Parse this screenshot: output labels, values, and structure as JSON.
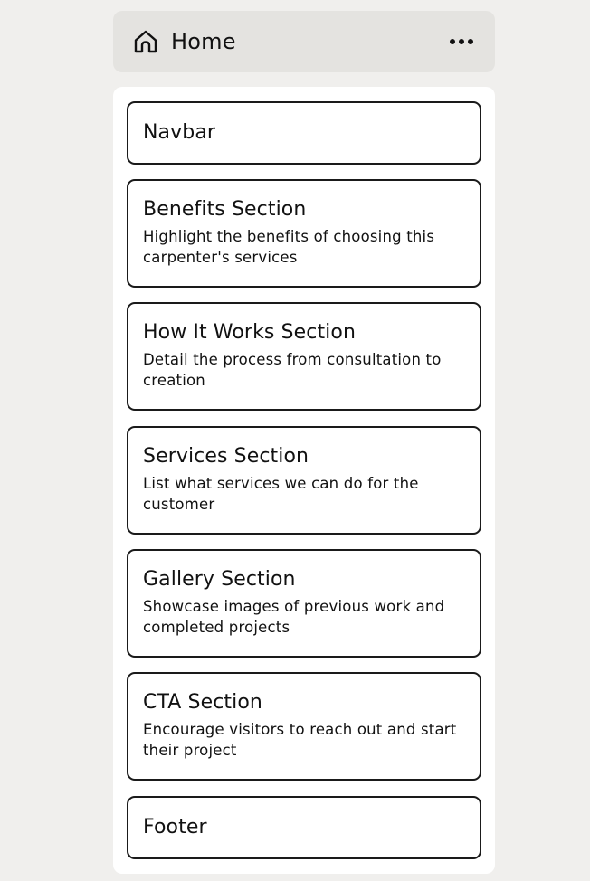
{
  "header": {
    "title": "Home",
    "icon": "home-icon",
    "more_icon": "more-horizontal-icon"
  },
  "sections": [
    {
      "title": "Navbar",
      "description": ""
    },
    {
      "title": "Benefits Section",
      "description": "Highlight the benefits of choosing this carpenter's services"
    },
    {
      "title": "How It Works Section",
      "description": "Detail the process from consultation to creation"
    },
    {
      "title": "Services Section",
      "description": "List what services we can do for the customer"
    },
    {
      "title": "Gallery Section",
      "description": "Showcase images of previous work and completed projects"
    },
    {
      "title": "CTA Section",
      "description": "Encourage visitors to reach out and start their project"
    },
    {
      "title": "Footer",
      "description": ""
    }
  ],
  "colors": {
    "background": "#f0efed",
    "header_bg": "#e4e3e0",
    "panel_bg": "#ffffff",
    "border": "#1a1a1a",
    "text": "#111111"
  }
}
